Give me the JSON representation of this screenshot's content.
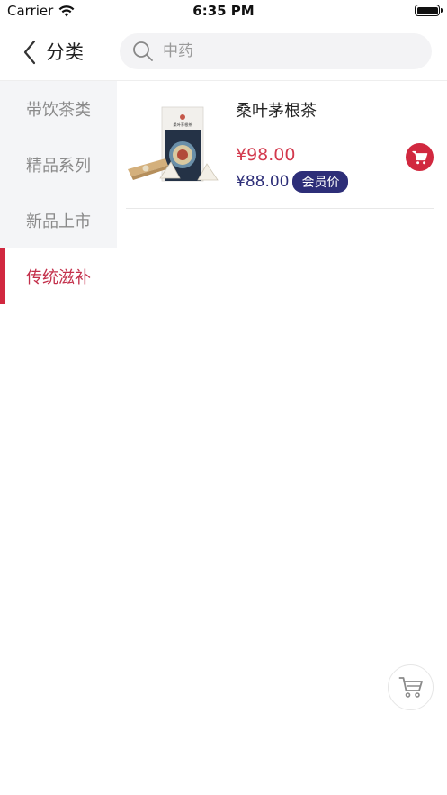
{
  "status_bar": {
    "carrier": "Carrier",
    "time": "6:35 PM"
  },
  "nav": {
    "title": "分类",
    "search": {
      "value": "",
      "placeholder": "中药"
    }
  },
  "sidebar": {
    "items": [
      {
        "label": "带饮茶类",
        "active": false
      },
      {
        "label": "精品系列",
        "active": false
      },
      {
        "label": "新品上市",
        "active": false
      },
      {
        "label": "传统滋补",
        "active": true
      }
    ]
  },
  "products": [
    {
      "name": "桑叶茅根茶",
      "price": "¥98.00",
      "member_price": "¥88.00",
      "member_badge": "会员价",
      "package_label": "桑叶茅根茶"
    }
  ],
  "icons": {
    "back": "chevron-left-icon",
    "search": "search-icon",
    "cart": "cart-icon"
  },
  "colors": {
    "accent_red": "#d1283f",
    "member_navy": "#2d2e78",
    "sidebar_bg": "#f4f5f7",
    "search_bg": "#f3f3f5"
  }
}
